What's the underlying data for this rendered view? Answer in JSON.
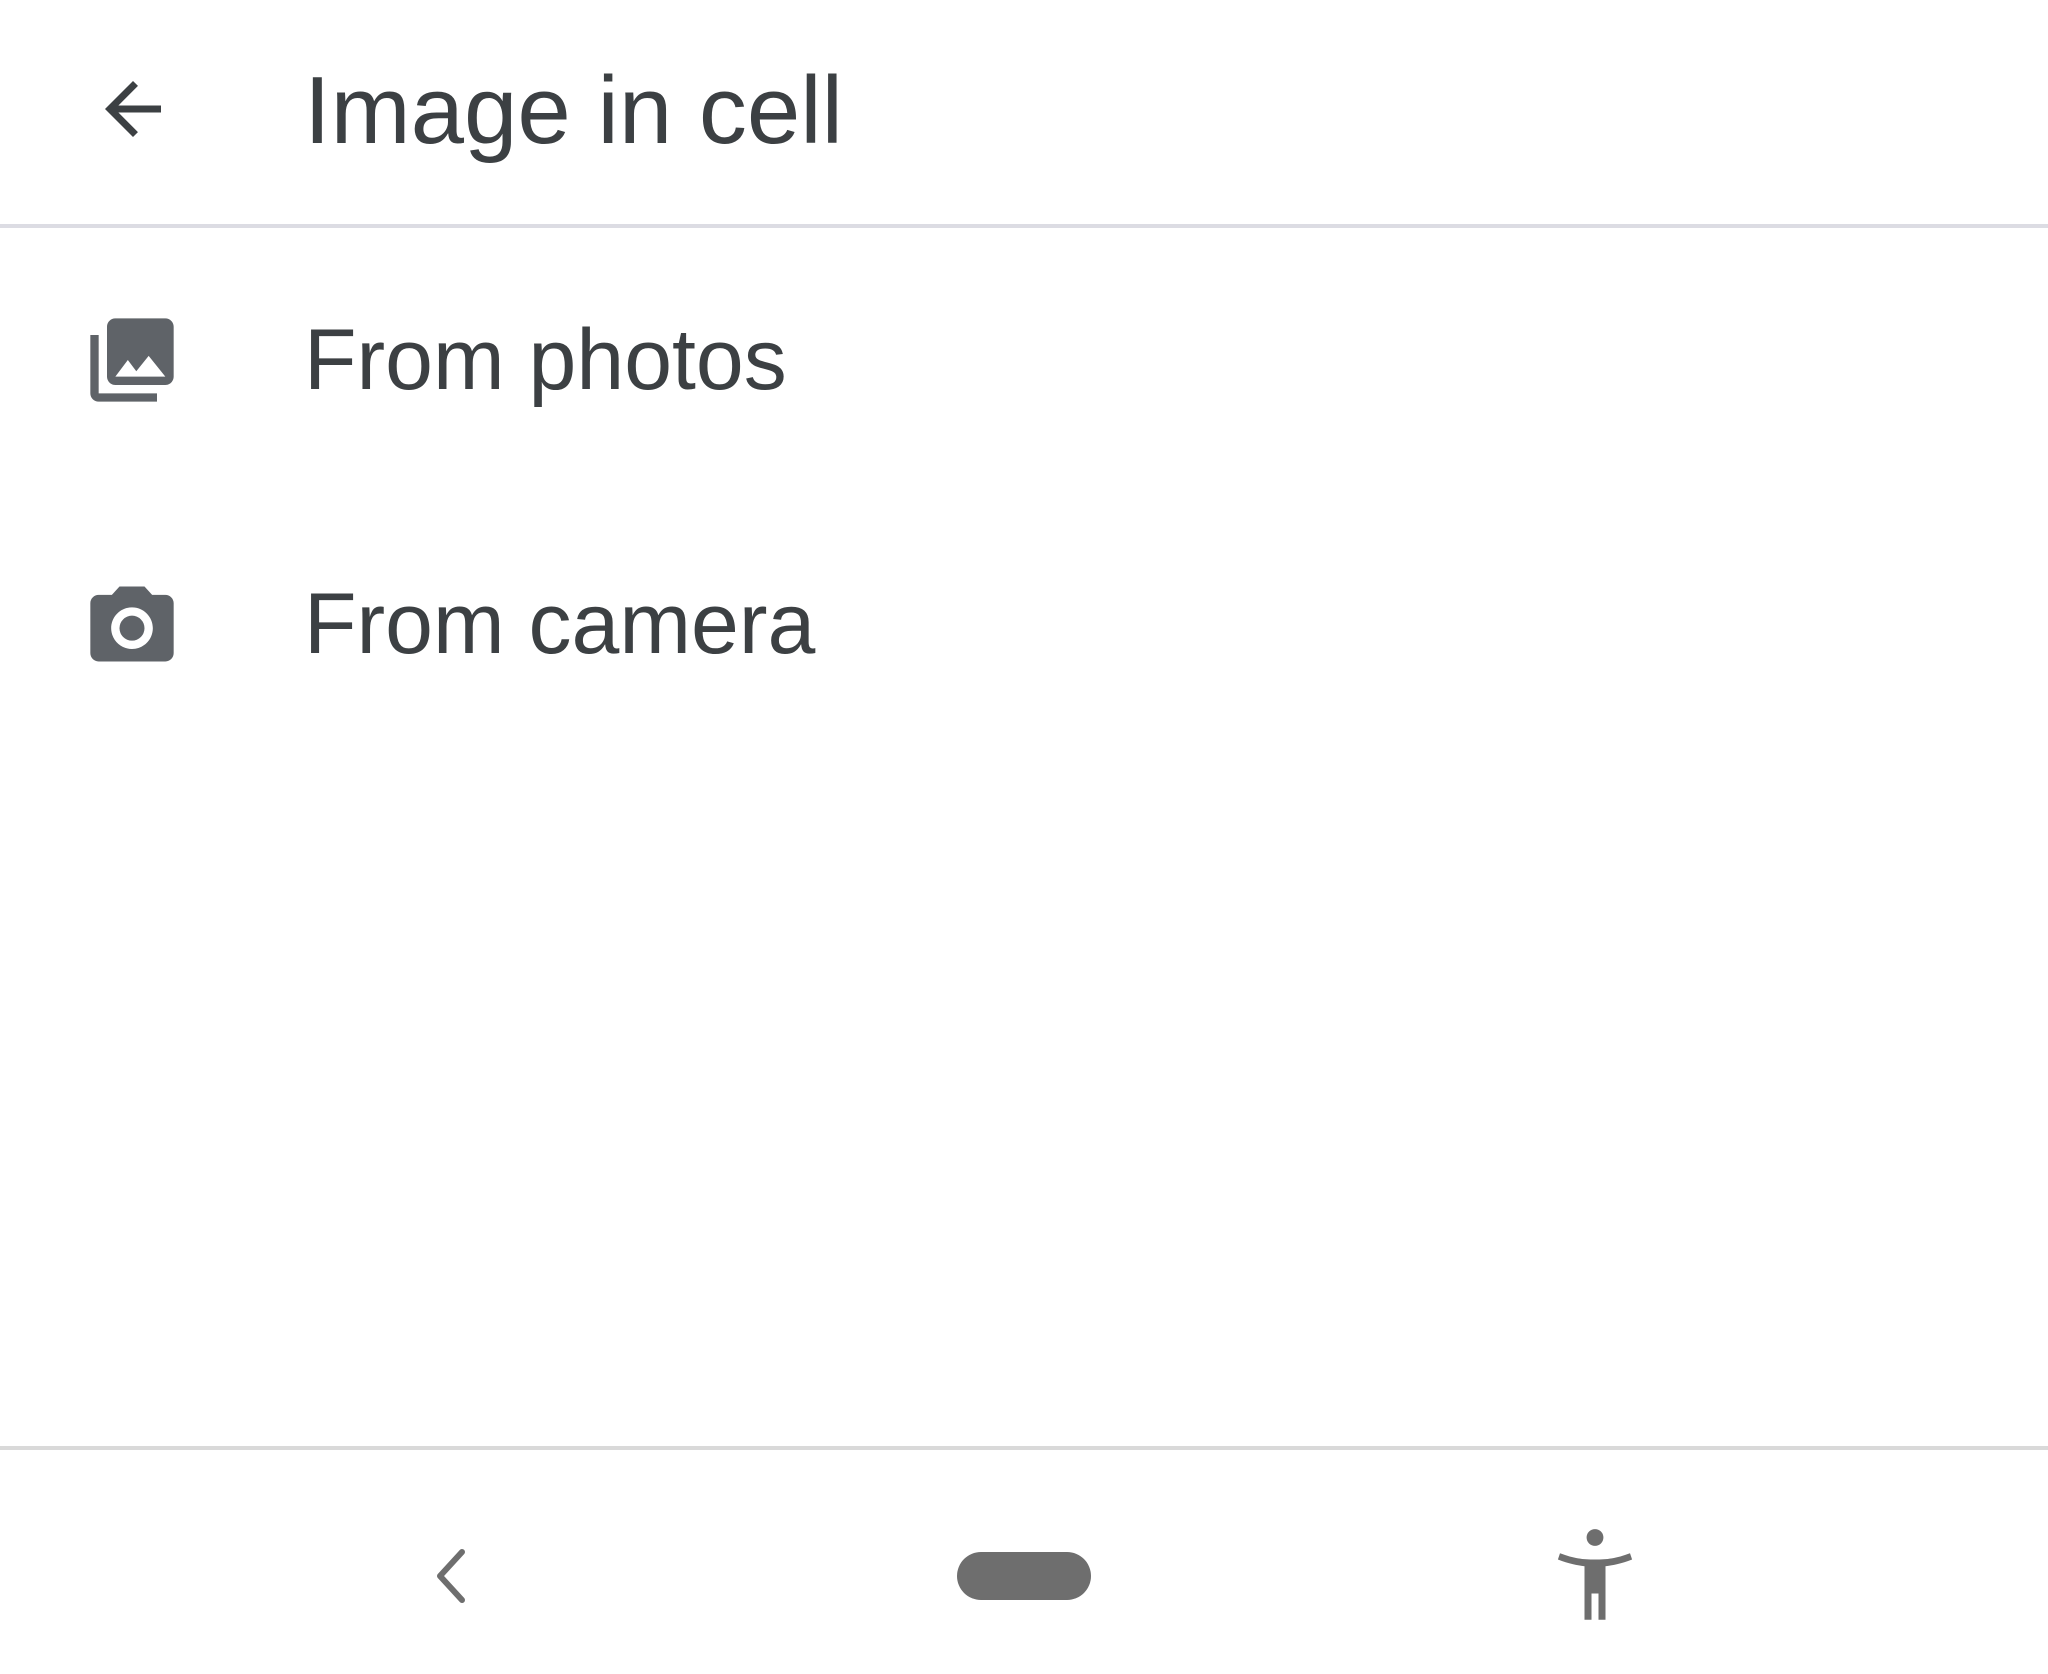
{
  "appbar": {
    "title": "Image in cell",
    "back_icon": "arrow-back-icon"
  },
  "options": [
    {
      "label": "From photos",
      "icon": "photo-library-icon"
    },
    {
      "label": "From camera",
      "icon": "camera-icon"
    }
  ],
  "navbar": {
    "back_icon": "nav-back-icon",
    "home_icon": "home-pill-icon",
    "accessibility_icon": "accessibility-icon"
  },
  "colors": {
    "text": "#3c4043",
    "icon": "#5f6368",
    "divider": "#dcdce3",
    "nav_icon": "#6e6e6e",
    "background": "#ffffff"
  }
}
